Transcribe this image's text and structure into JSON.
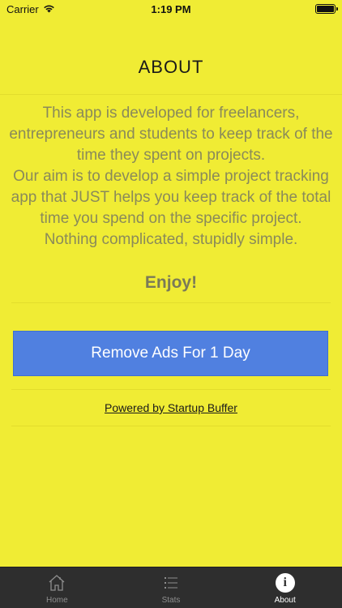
{
  "status_bar": {
    "carrier": "Carrier",
    "time": "1:19 PM"
  },
  "header": {
    "title": "ABOUT"
  },
  "about": {
    "lines": [
      "This app is developed for freelancers, entrepreneurs and students to keep track of the time they spent on projects.",
      "Our aim is to develop a simple project tracking app that JUST helps you keep track of the total time you spend on the specific project.",
      "Nothing complicated, stupidly simple."
    ],
    "enjoy": "Enjoy!"
  },
  "remove_ads_button": {
    "label": "Remove Ads For 1 Day"
  },
  "powered_by": {
    "label": "Powered by Startup Buffer"
  },
  "tab_bar": {
    "tabs": [
      {
        "label": "Home",
        "icon": "home-icon"
      },
      {
        "label": "Stats",
        "icon": "list-icon"
      },
      {
        "label": "About",
        "icon": "info-icon",
        "active": true
      }
    ]
  },
  "colors": {
    "background": "#f0ec34",
    "button": "#5080e0",
    "tab_bar": "#2e2e2e",
    "text_muted": "#8a8a5a"
  }
}
